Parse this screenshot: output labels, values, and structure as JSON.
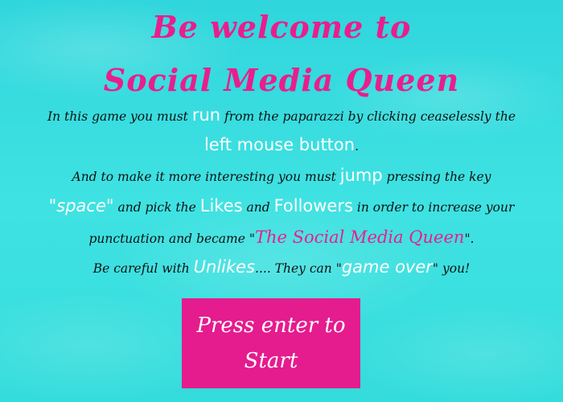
{
  "title": {
    "line1": "Be welcome to",
    "line2": "Social Media Queen"
  },
  "instructions": {
    "l1": {
      "a": "In this game you must ",
      "run": "run",
      "b": " from the paparazzi by clicking ceaselessly the"
    },
    "l2": {
      "left_mouse": "left mouse button",
      "end": "."
    },
    "l3": {
      "a": "And to make it more interesting you must ",
      "jump": "jump",
      "b": " pressing the key"
    },
    "l4": {
      "space": "\"space\"",
      "a": " and pick the ",
      "likes": "Likes",
      "b": " and ",
      "followers": "Followers",
      "c": " in order to increase your"
    },
    "l5": {
      "a": "punctuation and became \"",
      "queen": "The Social Media Queen",
      "b": "\"."
    },
    "l6": {
      "a": "Be careful with ",
      "unlikes": "Unlikes",
      "b": ".... They can \"",
      "game_over": "game over",
      "c": "\" you!"
    }
  },
  "start_button": {
    "line1": "Press enter to",
    "line2": "Start"
  },
  "colors": {
    "background": "#3fe2e2",
    "accent_pink": "#e91e8c",
    "highlight_white": "#ffffff",
    "text_dark": "#111111"
  }
}
